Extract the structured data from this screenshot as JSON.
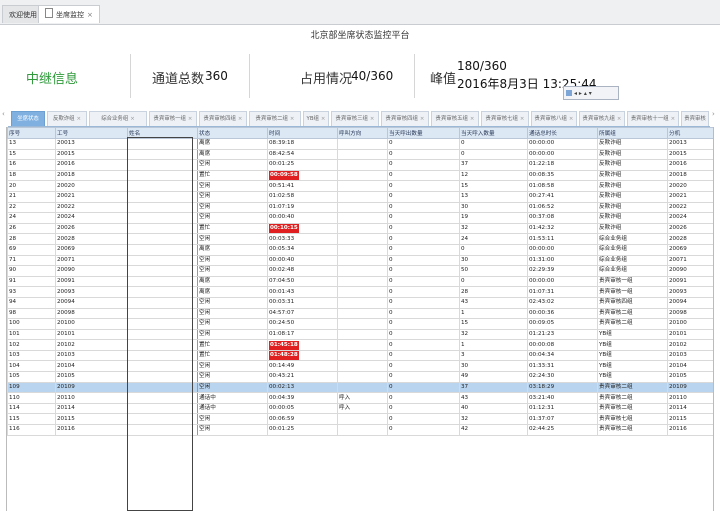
{
  "top_tabs": [
    {
      "label": "欢迎使用",
      "active": false
    },
    {
      "label": "坐席监控",
      "active": true,
      "close": "×"
    }
  ],
  "title": "北京部坐席状态监控平台",
  "stats": {
    "relay_label": "中继信息",
    "channels_label": "通道总数",
    "channels_value": "360",
    "usage_label": "占用情况",
    "usage_value": "40/360",
    "peak_label": "峰值",
    "peak_value": "180/360",
    "peak_time": "2016年8月3日 13:25:44"
  },
  "mini_tool_text": "◂ ▸ ▴ ▾",
  "group_tabs": [
    {
      "label": "坐席状态",
      "active": true
    },
    {
      "label": "反欺诈组",
      "active": false
    },
    {
      "label": "综合业务组",
      "active": false
    },
    {
      "label": "贵宾审核一组",
      "active": false
    },
    {
      "label": "贵宾审核四组",
      "active": false
    },
    {
      "label": "贵宾审核二组",
      "active": false
    },
    {
      "label": "YB组",
      "active": false
    },
    {
      "label": "贵宾审核三组",
      "active": false
    },
    {
      "label": "贵宾审核四组",
      "active": false
    },
    {
      "label": "贵宾审核五组",
      "active": false
    },
    {
      "label": "贵宾审核七组",
      "active": false
    },
    {
      "label": "贵宾审核八组",
      "active": false
    },
    {
      "label": "贵宾审核九组",
      "active": false
    },
    {
      "label": "贵宾审核十一组",
      "active": false
    },
    {
      "label": "贵宾审核",
      "active": false
    }
  ],
  "table": {
    "columns": [
      "序号",
      "工号",
      "姓名",
      "状态",
      "时间",
      "呼叫方向",
      "当天呼出数量",
      "当天呼入数量",
      "通话总时长",
      "所属组",
      "分机"
    ],
    "rows": [
      [
        "13",
        "20013",
        "",
        "离席",
        "08:39:18",
        "",
        "0",
        "0",
        "00:00:00",
        "反欺诈组",
        "20013"
      ],
      [
        "15",
        "20015",
        "",
        "离席",
        "08:42:54",
        "",
        "0",
        "0",
        "00:00:00",
        "反欺诈组",
        "20015"
      ],
      [
        "16",
        "20016",
        "",
        "空闲",
        "00:01:25",
        "",
        "0",
        "37",
        "01:22:18",
        "反欺诈组",
        "20016"
      ],
      [
        "18",
        "20018",
        "",
        "置忙",
        "00:09:58",
        "",
        "0",
        "12",
        "00:08:35",
        "反欺诈组",
        "20018"
      ],
      [
        "20",
        "20020",
        "",
        "空闲",
        "00:51:41",
        "",
        "0",
        "15",
        "01:08:58",
        "反欺诈组",
        "20020"
      ],
      [
        "21",
        "20021",
        "",
        "空闲",
        "01:02:58",
        "",
        "0",
        "13",
        "00:27:41",
        "反欺诈组",
        "20021"
      ],
      [
        "22",
        "20022",
        "",
        "空闲",
        "01:07:19",
        "",
        "0",
        "30",
        "01:06:52",
        "反欺诈组",
        "20022"
      ],
      [
        "24",
        "20024",
        "",
        "空闲",
        "00:00:40",
        "",
        "0",
        "19",
        "00:37:08",
        "反欺诈组",
        "20024"
      ],
      [
        "26",
        "20026",
        "",
        "置忙",
        "00:10:15",
        "",
        "0",
        "32",
        "01:42:32",
        "反欺诈组",
        "20026"
      ],
      [
        "28",
        "20028",
        "",
        "空闲",
        "00:03:33",
        "",
        "0",
        "24",
        "01:53:11",
        "综合业务组",
        "20028"
      ],
      [
        "69",
        "20069",
        "",
        "离席",
        "00:05:34",
        "",
        "0",
        "0",
        "00:00:00",
        "综合业务组",
        "20069"
      ],
      [
        "71",
        "20071",
        "",
        "空闲",
        "00:00:40",
        "",
        "0",
        "30",
        "01:31:00",
        "综合业务组",
        "20071"
      ],
      [
        "90",
        "20090",
        "",
        "空闲",
        "00:02:48",
        "",
        "0",
        "50",
        "02:29:39",
        "综合业务组",
        "20090"
      ],
      [
        "91",
        "20091",
        "",
        "离席",
        "07:04:50",
        "",
        "0",
        "0",
        "00:00:00",
        "贵宾审核一组",
        "20091"
      ],
      [
        "93",
        "20093",
        "",
        "离席",
        "00:01:43",
        "",
        "0",
        "28",
        "01:07:31",
        "贵宾审核一组",
        "20093"
      ],
      [
        "94",
        "20094",
        "",
        "空闲",
        "00:03:31",
        "",
        "0",
        "43",
        "02:43:02",
        "贵宾审核四组",
        "20094"
      ],
      [
        "98",
        "20098",
        "",
        "空闲",
        "04:57:07",
        "",
        "0",
        "1",
        "00:00:36",
        "贵宾审核二组",
        "20098"
      ],
      [
        "100",
        "20100",
        "",
        "空闲",
        "00:24:50",
        "",
        "0",
        "15",
        "00:09:05",
        "贵宾审核二组",
        "20100"
      ],
      [
        "101",
        "20101",
        "",
        "空闲",
        "01:08:17",
        "",
        "0",
        "32",
        "01:21:23",
        "YB组",
        "20101"
      ],
      [
        "102",
        "20102",
        "",
        "置忙",
        "01:45:18",
        "",
        "0",
        "1",
        "00:00:08",
        "YB组",
        "20102"
      ],
      [
        "103",
        "20103",
        "",
        "置忙",
        "01:48:28",
        "",
        "0",
        "3",
        "00:04:34",
        "YB组",
        "20103"
      ],
      [
        "104",
        "20104",
        "",
        "空闲",
        "00:14:49",
        "",
        "0",
        "30",
        "01:33:31",
        "YB组",
        "20104"
      ],
      [
        "105",
        "20105",
        "",
        "空闲",
        "00:43:21",
        "",
        "0",
        "49",
        "02:24:30",
        "YB组",
        "20105"
      ],
      [
        "109",
        "20109",
        "",
        "空闲",
        "00:02:13",
        "",
        "0",
        "37",
        "03:18:29",
        "贵宾审核二组",
        "20109"
      ],
      [
        "110",
        "20110",
        "",
        "通话中",
        "00:04:39",
        "呼入",
        "0",
        "43",
        "03:21:40",
        "贵宾审核二组",
        "20110"
      ],
      [
        "114",
        "20114",
        "",
        "通话中",
        "00:00:05",
        "呼入",
        "0",
        "40",
        "01:12:31",
        "贵宾审核二组",
        "20114"
      ],
      [
        "115",
        "20115",
        "",
        "空闲",
        "00:06:59",
        "",
        "0",
        "32",
        "01:37:07",
        "贵宾审核七组",
        "20115"
      ],
      [
        "116",
        "20116",
        "",
        "空闲",
        "00:01:25",
        "",
        "0",
        "42",
        "02:44:25",
        "贵宾审核二组",
        "20116"
      ]
    ]
  },
  "colors": {
    "busy_time": "#e02020",
    "highlight_row": "#b9d4ef",
    "relay_text": "#2e9a3a",
    "active_tab": "#7fb0e0"
  }
}
